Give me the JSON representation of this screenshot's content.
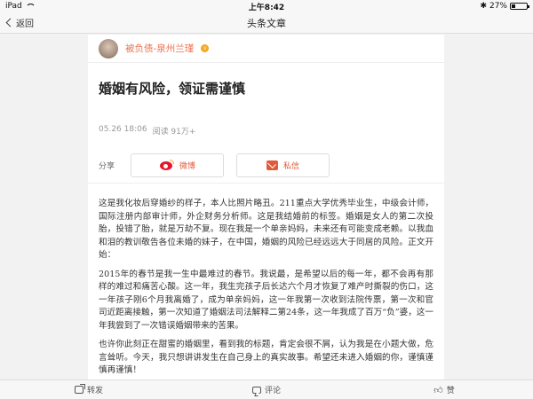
{
  "status_bar": {
    "device": "iPad",
    "time": "上午8:42",
    "battery": "27%",
    "battery_level": 0.27
  },
  "nav": {
    "back_label": "返回",
    "title": "头条文章"
  },
  "author": {
    "name": "被负债-泉州兰瑾",
    "badge_icon": "vip-badge-icon"
  },
  "article": {
    "title": "婚姻有风险，领证需谨慎",
    "date": "05.26 18:06",
    "read_count": "阅读 91万+",
    "paragraphs": [
      "这是我化妆后穿婚纱的样子，本人比照片略丑。211重点大学优秀毕业生，中级会计师，国际注册内部审计师，外企财务分析师。这是我结婚前的标签。婚姻是女人的第二次投胎，投错了胎，就是万劫不复。现在我是一个单亲妈妈，未来还有可能变成老赖。以我血和泪的教训敬告各位未婚的妹子，在中国，婚姻的风险已经远远大于同居的风险。正文开始：",
      "2015年的春节是我一生中最难过的春节。我说最，是希望以后的每一年，都不会再有那样的难过和痛苦心酸。这一年，我生完孩子后长达六个月才恢复了难产时撕裂的伤口，这一年孩子刚6个月我离婚了，成为单亲妈妈，这一年我第一次收到法院传票，第一次和官司近距离接触，第一次知道了婚姻法司法解释二第24条，这一年我成了百万“负”婆，这一年我尝到了一次错误婚姻带来的苦果。",
      "也许你此刻正在甜蜜的婚姻里，看到我的标题，肯定会很不屑，认为我是在小题大做，危言耸听。今天，我只想讲讲发生在自己身上的真实故事。希望还未进入婚姻的你，谨慎谨慎再谨慎！"
    ]
  },
  "share": {
    "label": "分享",
    "weibo_label": "微博",
    "message_label": "私信"
  },
  "bottom_bar": {
    "forward_label": "转发",
    "comment_label": "评论",
    "like_label": "赞"
  },
  "colors": {
    "accent": "#eb7350",
    "weibo_red": "#e6162d"
  }
}
